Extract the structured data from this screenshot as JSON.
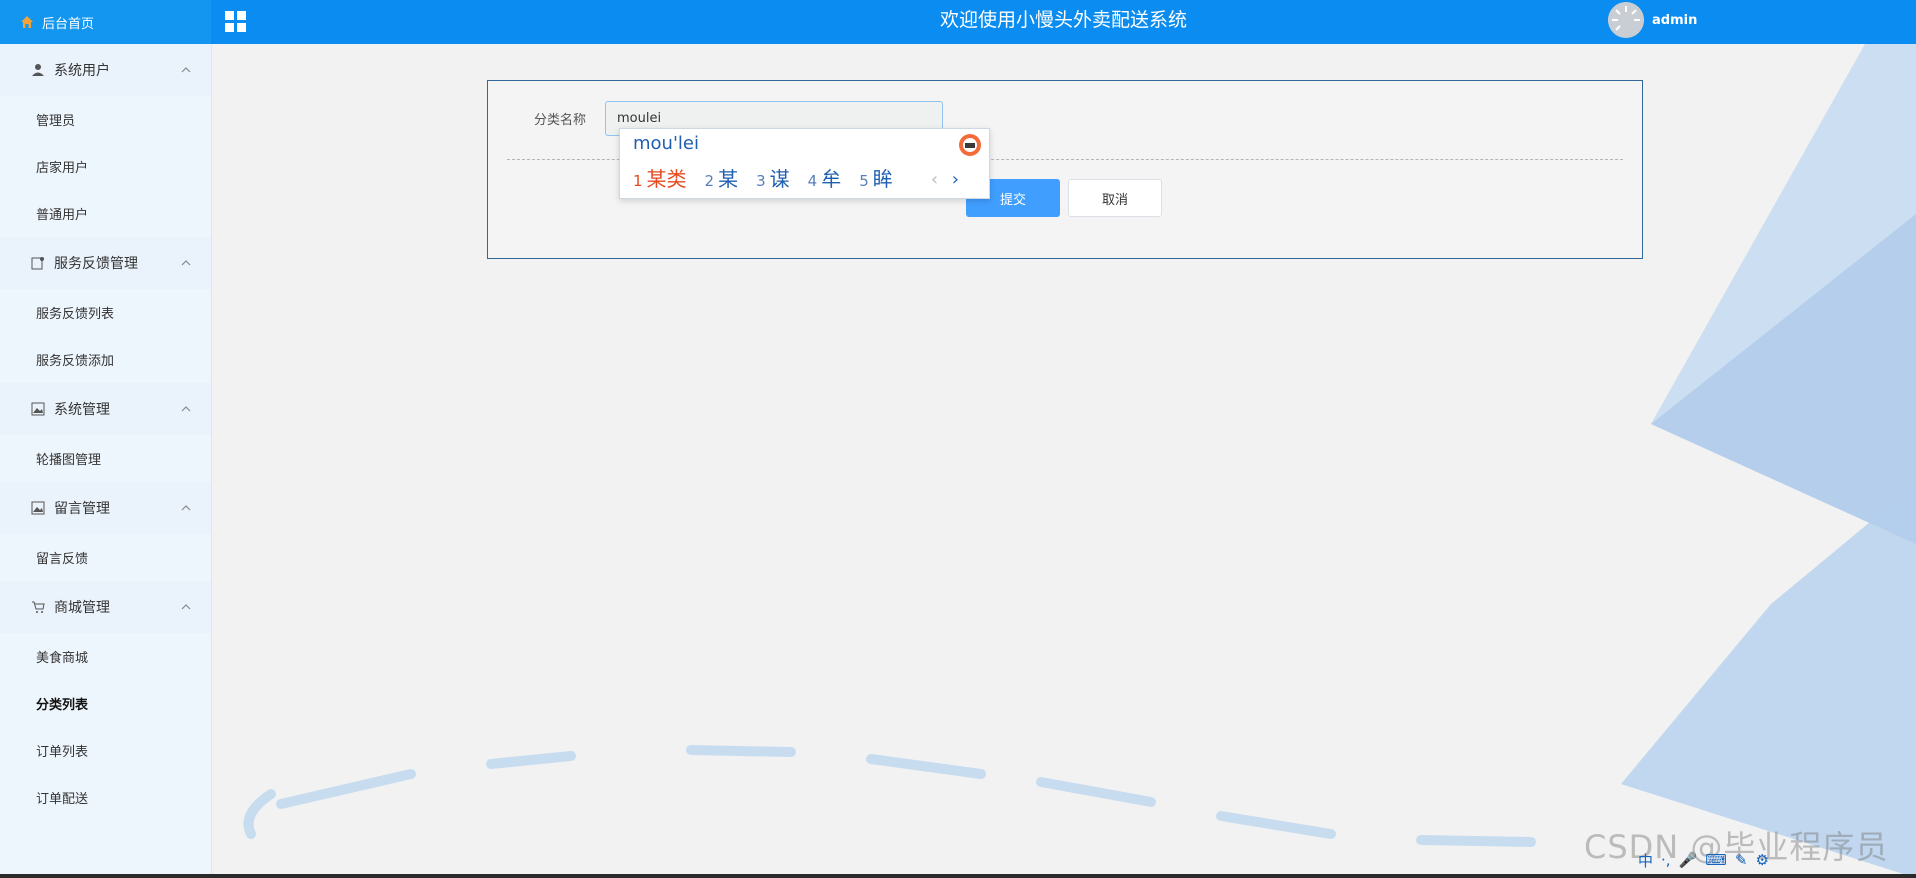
{
  "brand": {
    "label": "后台首页",
    "icon": "home-icon"
  },
  "topbar": {
    "title": "欢迎使用小慢头外卖配送系统",
    "username": "admin"
  },
  "sidebar": {
    "groups": [
      {
        "label": "系统用户",
        "icon": "user-icon",
        "items": [
          "管理员",
          "店家用户",
          "普通用户"
        ]
      },
      {
        "label": "服务反馈管理",
        "icon": "feedback-icon",
        "items": [
          "服务反馈列表",
          "服务反馈添加"
        ]
      },
      {
        "label": "系统管理",
        "icon": "image-icon",
        "items": [
          "轮播图管理"
        ]
      },
      {
        "label": "留言管理",
        "icon": "image-icon",
        "items": [
          "留言反馈"
        ]
      },
      {
        "label": "商城管理",
        "icon": "cart-icon",
        "items": [
          "美食商城",
          "分类列表",
          "订单列表",
          "订单配送"
        ]
      }
    ],
    "active_item": "分类列表"
  },
  "form": {
    "label": "分类名称",
    "value": "moulei",
    "submit_label": "提交",
    "cancel_label": "取消"
  },
  "ime": {
    "pinyin": "mou'lei",
    "candidates": [
      {
        "num": "1",
        "text": "某类"
      },
      {
        "num": "2",
        "text": "某"
      },
      {
        "num": "3",
        "text": "谋"
      },
      {
        "num": "4",
        "text": "牟"
      },
      {
        "num": "5",
        "text": "眸"
      }
    ],
    "prev": "‹",
    "next": "›"
  },
  "watermark": "CSDN @毕业程序员",
  "tray": [
    "中",
    "·,",
    "🎤",
    "⌨",
    "✎",
    "⚙"
  ],
  "colors": {
    "topbar": "#0a8cf0",
    "brand": "#1296f0",
    "submit": "#409eff",
    "sidebar": "#eef6fd"
  }
}
